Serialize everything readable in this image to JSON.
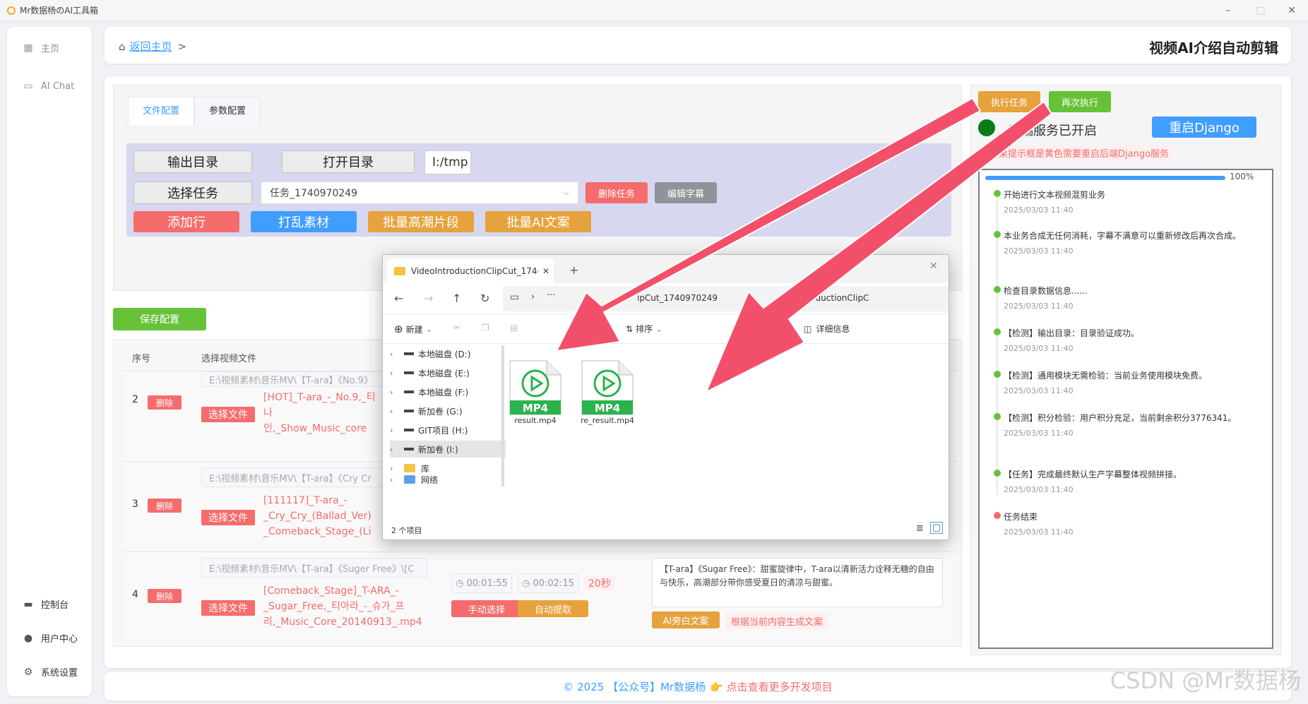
{
  "window": {
    "title": "Mr数据杨のAI工具箱"
  },
  "sidebar": {
    "top_items": [
      {
        "label": "主页"
      },
      {
        "label": "AI Chat"
      }
    ],
    "bottom_items": [
      {
        "label": "控制台"
      },
      {
        "label": "用户中心"
      },
      {
        "label": "系统设置"
      }
    ]
  },
  "header": {
    "back_label": "返回主页",
    "separator": ">",
    "title": "视频AI介绍自动剪辑"
  },
  "config": {
    "tabs": [
      {
        "label": "文件配置"
      },
      {
        "label": "参数配置"
      }
    ],
    "output_dir_button": "输出目录",
    "open_dir_button": "打开目录",
    "path_value": "I:/tmp",
    "select_task_button": "选择任务",
    "task_select_value": "任务_1740970249",
    "delete_task_button": "删除任务",
    "edit_subtitle_button": "编辑字幕",
    "add_row_button": "添加行",
    "shuffle_button": "打乱素材",
    "batch_climax_button": "批量高潮片段",
    "batch_ai_button": "批量AI文案",
    "save_button": "保存配置"
  },
  "table": {
    "headers": [
      "序号",
      "选择视频文件"
    ],
    "rows": [
      {
        "index": "2",
        "delete": "删除",
        "choose": "选择文件",
        "path": "E:\\视频素材\\音乐MV\\【T-ara】《No.9》",
        "filename": "[HOT]_T-ara_-_No.9,_티\n나\n인,_Show_Music_core"
      },
      {
        "index": "3",
        "delete": "删除",
        "choose": "选择文件",
        "path": "E:\\视频素材\\音乐MV\\【T-ara】《Cry Cr",
        "filename": "[111117]_T-ara_-\n_Cry_Cry_(Ballad_Ver)\n_Comeback_Stage_(Li"
      },
      {
        "index": "4",
        "delete": "删除",
        "choose": "选择文件",
        "path": "E:\\视频素材\\音乐MV\\【T-ara】《Suger Free》\\[C",
        "filename": "[Comeback_Stage]_T-ARA_-\n_Sugar_Free,_티아라_-_슈가_프\n리,_Music_Core_20140913_.mp4"
      }
    ],
    "row4": {
      "start_time": "00:01:55",
      "end_time": "00:02:15",
      "duration": "20秒",
      "manual_button": "手动选择",
      "auto_button": "自动提取",
      "copy_text": "【T-ara】《Sugar Free》：甜蜜旋律中，T-ara以清新活力诠释无糖的自由与快乐，高潮部分带你感受夏日的清凉与甜蜜。",
      "ai_button": "AI旁白文案",
      "gen_button": "根据当前内容生成文案"
    }
  },
  "right": {
    "execute_button": "执行任务",
    "re_execute_button": "再次执行",
    "status_text": "后端服务已开启",
    "restart_button": "重启Django",
    "warning": "如果提示框是黄色需要重启后端Django服务",
    "progress_label": "100%",
    "progress_value": 1.0,
    "log": [
      {
        "text": "开始进行文本视频混剪业务",
        "time": "2025/03/03 11:40"
      },
      {
        "text": "本业务合成无任何消耗，字幕不满意可以重新修改后再次合成。",
        "time": "2025/03/03 11:40"
      },
      {
        "text": "检查目录数据信息......",
        "time": "2025/03/03 11:40"
      },
      {
        "text": "【检测】输出目录：目录验证成功。",
        "time": "2025/03/03 11:40"
      },
      {
        "text": "【检测】通用模块无需检验：当前业务使用模块免费。",
        "time": "2025/03/03 11:40"
      },
      {
        "text": "【检测】积分检验：用户积分充足，当前剩余积分3776341。",
        "time": "2025/03/03 11:40"
      },
      {
        "text": "【任务】完成最终默认生产字幕整体视频拼接。",
        "time": "2025/03/03 11:40"
      },
      {
        "text": "任务结束",
        "time": "2025/03/03 11:40",
        "color": "#f56c6c"
      }
    ]
  },
  "explorer": {
    "tab_title": "VideoIntroductionClipCut_174(",
    "address_part1": "ipCut_1740970249",
    "address_part2": "eoIntroductionClipC",
    "new_label": "新建",
    "sort_label": "排序",
    "details_label": "详细信息",
    "tree": [
      {
        "label": "本地磁盘 (D:)"
      },
      {
        "label": "本地磁盘 (E:)"
      },
      {
        "label": "本地磁盘 (F:)"
      },
      {
        "label": "新加卷 (G:)"
      },
      {
        "label": "GIT项目 (H:)"
      },
      {
        "label": "新加卷 (I:)"
      },
      {
        "label": "库"
      },
      {
        "label": "网络"
      }
    ],
    "files": [
      {
        "badge": "MP4",
        "name": "result.mp4"
      },
      {
        "badge": "MP4",
        "name": "re_result.mp4"
      }
    ],
    "status": "2 个项目"
  },
  "footer": {
    "copyright": "© 2025 【公众号】Mr数据杨",
    "link": "👉 点击查看更多开发项目"
  },
  "watermark": "CSDN @Mr数据杨",
  "colors": {
    "primary": "#409eff",
    "danger": "#f56c6c",
    "warning": "#e6a23c",
    "success": "#67c23a",
    "arrow": "#f2506a"
  }
}
